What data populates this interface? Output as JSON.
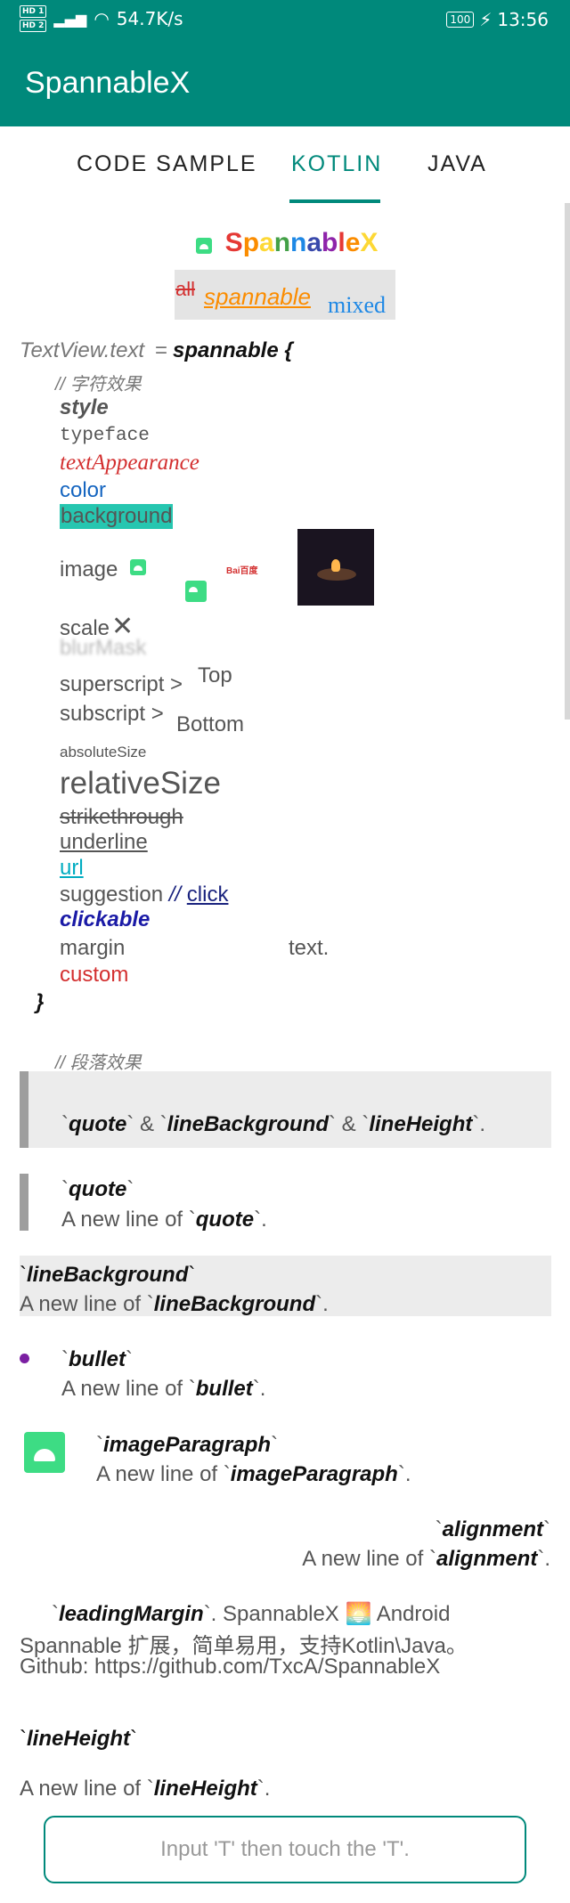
{
  "status": {
    "hd1": "HD 1",
    "hd2": "HD 2",
    "speed": "54.7K/s",
    "battery": "100",
    "time": "13:56"
  },
  "app": {
    "title": "SpannableX"
  },
  "tabs": [
    {
      "label": "CODE SAMPLE"
    },
    {
      "label": "KOTLIN"
    },
    {
      "label": "JAVA"
    }
  ],
  "content": {
    "header_logo": "SpannableX",
    "header_logo_letters": [
      "S",
      "p",
      "a",
      "n",
      "n",
      "a",
      "b",
      "l",
      "e",
      "X"
    ],
    "header_logo_colors": [
      "#e53935",
      "#fb8c00",
      "#fdd835",
      "#43a047",
      "#1e88e5",
      "#3949ab",
      "#8e24aa",
      "#e53935",
      "#fb8c00",
      "#fdd835"
    ],
    "mixed_all": "all",
    "mixed_spannable": "spannable",
    "mixed_mixed": "mixed",
    "code_prefix": "TextView.text",
    "code_eq": "=",
    "code_fn": "spannable {",
    "comment_char": "// 字符效果",
    "style": "style",
    "typeface": "typeface",
    "textAppearance": "textAppearance",
    "color": "color",
    "background": "background",
    "image": "image",
    "baidu": "Bai百度",
    "scale": "scale",
    "blurMask": "blurMask",
    "superscript": "superscript >",
    "superscript_val": "Top",
    "subscript": "subscript >",
    "subscript_val": "Bottom",
    "absoluteSize": "absoluteSize",
    "relativeSize": "relativeSize",
    "strikethrough": "strikethrough",
    "underline": "underline",
    "url": "url",
    "suggestion": "suggestion",
    "suggestion_comment": "//",
    "suggestion_click": "click",
    "clickable": "clickable",
    "margin": "margin",
    "margin_text": "text.",
    "custom": "custom",
    "close_brace": "}",
    "comment_para": "// 段落效果",
    "quote_block_text": [
      "`",
      "quote",
      "` & `",
      "lineBackground",
      "` & `",
      "lineHeight",
      "`."
    ],
    "quote_title": [
      "`",
      "quote",
      "`"
    ],
    "quote_line": [
      "A new line of `",
      "quote",
      "`."
    ],
    "lineBg_title": [
      "`",
      "lineBackground",
      "`"
    ],
    "lineBg_line": [
      "A new line of `",
      "lineBackground",
      "`."
    ],
    "bullet_title": [
      "`",
      "bullet",
      "`"
    ],
    "bullet_line": [
      "A new line of `",
      "bullet",
      "`."
    ],
    "imgPara_title": [
      "`",
      "imageParagraph",
      "`"
    ],
    "imgPara_line": [
      "A new line of `",
      "imageParagraph",
      "`."
    ],
    "align_title": [
      "`",
      "alignment",
      "`"
    ],
    "align_line": [
      "A new line of `",
      "alignment",
      "`."
    ],
    "leading_1_a": "`",
    "leading_1_b": "leadingMargin",
    "leading_1_c": "`. SpannableX",
    "leading_1_d": "Android",
    "leading_2": "Spannable 扩展，简单易用，支持Kotlin\\Java。",
    "leading_3": "Github: https://github.com/TxcA/SpannableX",
    "lineHeight_title": [
      "`",
      "lineHeight",
      "`"
    ],
    "lineHeight_line": [
      "A new line of `",
      "lineHeight",
      "`."
    ]
  },
  "input": {
    "placeholder": "Input 'T' then touch the 'T'."
  },
  "colors": {
    "accent": "#00897b",
    "red": "#d32f2f",
    "teal_bg": "#26c6b0",
    "blue": "#1565c0",
    "purple": "#7b1fa2"
  }
}
